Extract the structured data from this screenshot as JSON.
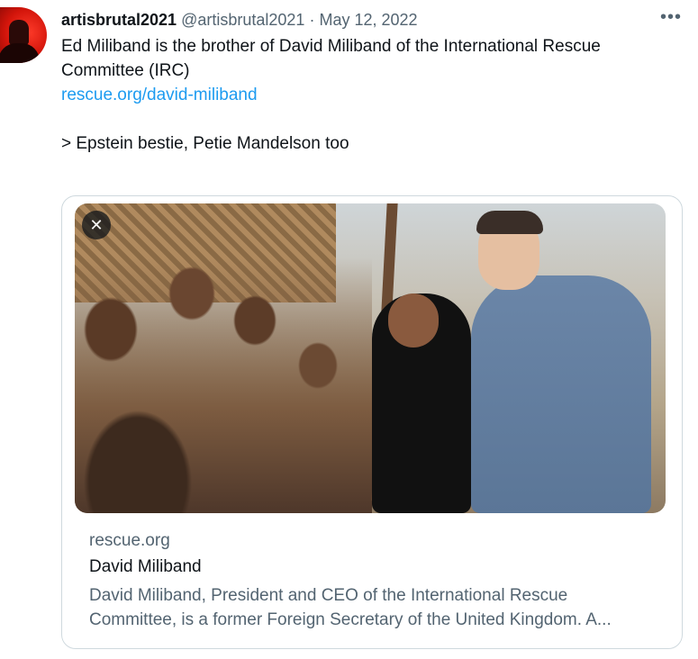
{
  "tweet": {
    "display_name": "artisbrutal2021",
    "handle": "@artisbrutal2021",
    "separator": "·",
    "date": "May 12, 2022",
    "more_label": "•••",
    "text_line1": "Ed Miliband is the brother of David Miliband of the International Rescue Committee (IRC)",
    "link_text": "rescue.org/david-miliband",
    "text_line2": "> Epstein bestie, Petie Mandelson too"
  },
  "card": {
    "close_label": "✕",
    "domain": "rescue.org",
    "title": "David Miliband",
    "description": "David Miliband, President and CEO of the International Rescue Committee, is a former Foreign Secretary of the United Kingdom. A..."
  },
  "icons": {
    "avatar": "avatar-image",
    "close": "close-icon",
    "more": "more-options-icon"
  },
  "colors": {
    "link": "#1d9bf0",
    "secondary_text": "#536471",
    "primary_text": "#0f1419",
    "border": "#cfd9de"
  }
}
